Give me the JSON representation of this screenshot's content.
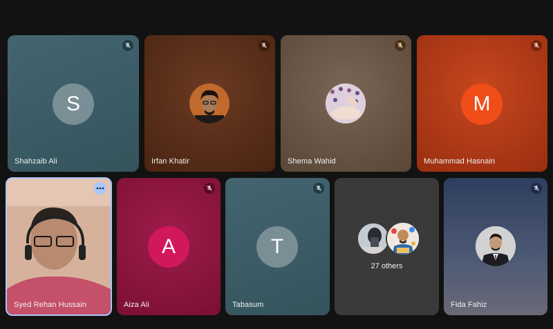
{
  "tiles": [
    {
      "name": "Shahzaib Ali",
      "initial": "S",
      "bg": "#3c5a62",
      "muted": true
    },
    {
      "name": "Irfan Khatir",
      "avatar": "photo",
      "bg": "#5a2d18",
      "muted": true
    },
    {
      "name": "Shema Wahid",
      "avatar": "photo",
      "bg": "#6e5848",
      "muted": true
    },
    {
      "name": "Muhammad Hasnain",
      "initial": "M",
      "bg": "#b33a16",
      "muted": true
    },
    {
      "name": "Syed Rehan Hussain",
      "video": true,
      "more_icon": "more-horizontal-icon"
    },
    {
      "name": "Aiza Ali",
      "initial": "A",
      "bg": "#8e1540",
      "muted": true
    },
    {
      "name": "Tabasum",
      "initial": "T",
      "bg": "#3c5a62",
      "muted": true
    },
    {
      "others_label": "27 others",
      "bg": "#3a3a3a"
    },
    {
      "name": "Fida Fahiz",
      "avatar": "photo",
      "bg": "#3a4a6a",
      "muted": true
    }
  ],
  "icons": {
    "mic": "mic-off-icon",
    "more": "more-horizontal-icon"
  }
}
